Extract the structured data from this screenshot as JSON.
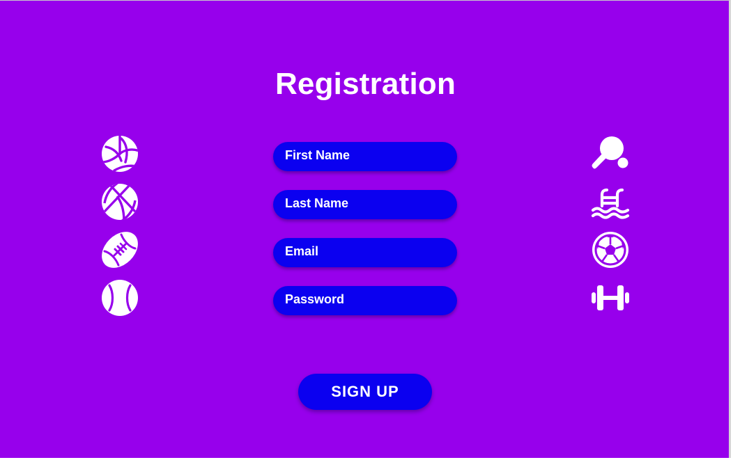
{
  "page": {
    "title": "Registration",
    "background_color": "#9700ec",
    "accent_color": "#0b00f0"
  },
  "form": {
    "fields": [
      {
        "name": "first_name",
        "placeholder": "First Name",
        "value": ""
      },
      {
        "name": "last_name",
        "placeholder": "Last Name",
        "value": ""
      },
      {
        "name": "email",
        "placeholder": "Email",
        "value": ""
      },
      {
        "name": "password",
        "placeholder": "Password",
        "value": ""
      }
    ],
    "submit_label": "SIGN UP"
  },
  "icons": {
    "left": [
      "volleyball-icon",
      "basketball-icon",
      "football-icon",
      "baseball-icon"
    ],
    "right": [
      "table-tennis-icon",
      "swimming-pool-icon",
      "soccer-ball-icon",
      "dumbbell-icon"
    ]
  }
}
